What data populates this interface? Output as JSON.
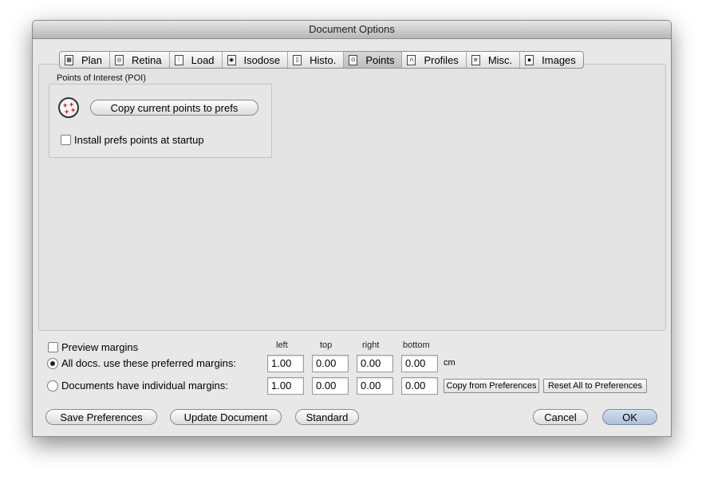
{
  "window": {
    "title": "Document Options"
  },
  "tabs": [
    {
      "label": "Plan",
      "icon": "plan-tab-icon",
      "selected": false
    },
    {
      "label": "Retina",
      "icon": "retina-tab-icon",
      "selected": false
    },
    {
      "label": "Load",
      "icon": "load-tab-icon",
      "selected": false
    },
    {
      "label": "Isodose",
      "icon": "isodose-tab-icon",
      "selected": false
    },
    {
      "label": "Histo.",
      "icon": "histo-tab-icon",
      "selected": false
    },
    {
      "label": "Points",
      "icon": "points-tab-icon",
      "selected": true
    },
    {
      "label": "Profiles",
      "icon": "profiles-tab-icon",
      "selected": false
    },
    {
      "label": "Misc.",
      "icon": "misc-tab-icon",
      "selected": false
    },
    {
      "label": "Images",
      "icon": "images-tab-icon",
      "selected": false
    }
  ],
  "poi": {
    "group_label": "Points of Interest (POI)",
    "copy_button": "Copy current points to prefs",
    "install_checkbox": "Install prefs points at startup",
    "install_checked": false
  },
  "margins": {
    "preview_label": "Preview margins",
    "preview_checked": false,
    "columns": [
      "left",
      "top",
      "right",
      "bottom"
    ],
    "unit": "cm",
    "all_docs_label": "All docs. use these preferred margins:",
    "all_docs_selected": true,
    "all_docs_values": [
      "1.00",
      "0.00",
      "0.00",
      "0.00"
    ],
    "individual_label": "Documents have individual margins:",
    "individual_selected": false,
    "individual_values": [
      "1.00",
      "0.00",
      "0.00",
      "0.00"
    ],
    "copy_from_prefs": "Copy from Preferences",
    "reset_all": "Reset All to Preferences"
  },
  "buttons": {
    "save_prefs": "Save Preferences",
    "update_doc": "Update Document",
    "standard": "Standard",
    "cancel": "Cancel",
    "ok": "OK"
  },
  "colors": {
    "default_button": "#aebfd8",
    "poi_marker": "#cc0000"
  }
}
